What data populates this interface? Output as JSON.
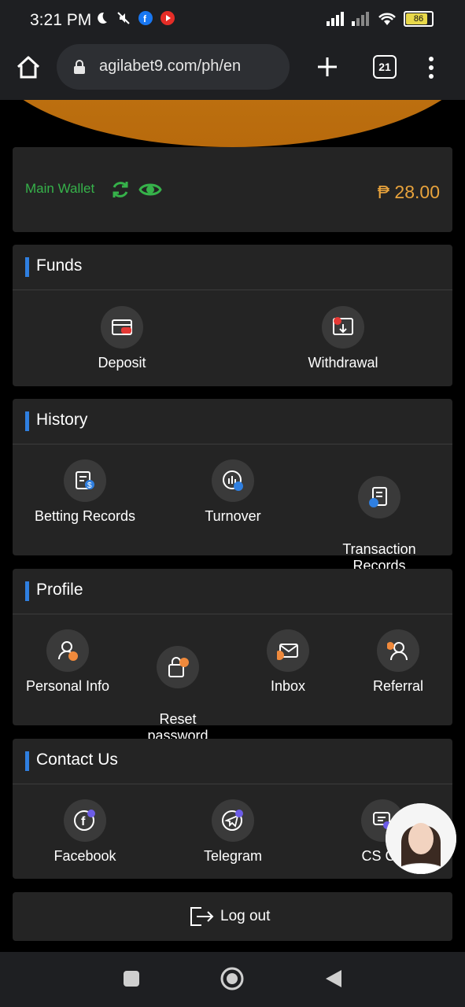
{
  "status": {
    "time": "3:21 PM",
    "battery": "86"
  },
  "browser": {
    "url": "agilabet9.com/ph/en",
    "tab_count": "21"
  },
  "wallet": {
    "label": "Main Wallet",
    "amount": "₱ 28.00"
  },
  "funds": {
    "title": "Funds",
    "items": [
      {
        "label": "Deposit"
      },
      {
        "label": "Withdrawal"
      }
    ]
  },
  "history": {
    "title": "History",
    "items": [
      {
        "label": "Betting Records"
      },
      {
        "label": "Turnover"
      },
      {
        "label": "Transaction\nRecords"
      }
    ]
  },
  "profile": {
    "title": "Profile",
    "items": [
      {
        "label": "Personal Info"
      },
      {
        "label": "Reset\npassword"
      },
      {
        "label": "Inbox"
      },
      {
        "label": "Referral"
      }
    ]
  },
  "contact": {
    "title": "Contact Us",
    "items": [
      {
        "label": "Facebook"
      },
      {
        "label": "Telegram"
      },
      {
        "label": "CS Ch"
      }
    ]
  },
  "logout": {
    "label": "Log out"
  },
  "colors": {
    "accent": "#2f7fe0",
    "wallet_green": "#36b24a",
    "amount_gold": "#e8a33c",
    "card_bg": "#242424"
  }
}
